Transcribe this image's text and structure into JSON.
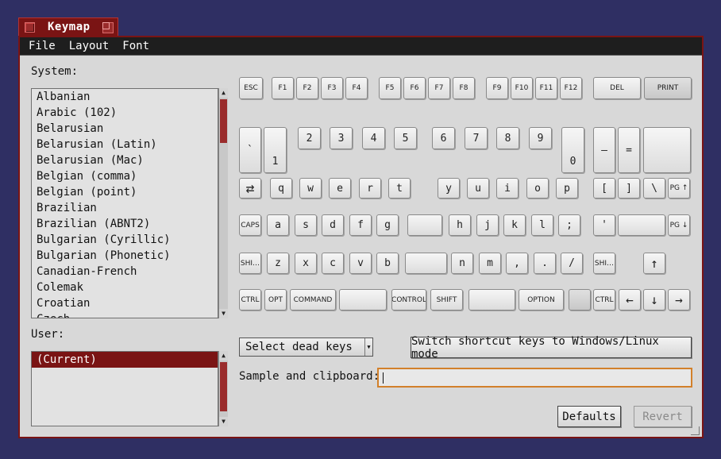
{
  "window": {
    "title": "Keymap"
  },
  "menu": [
    "File",
    "Layout",
    "Font"
  ],
  "system": {
    "label": "System:",
    "items": [
      "Albanian",
      "Arabic (102)",
      "Belarusian",
      "Belarusian (Latin)",
      "Belarusian (Mac)",
      "Belgian (comma)",
      "Belgian (point)",
      "Brazilian",
      "Brazilian (ABNT2)",
      "Bulgarian (Cyrillic)",
      "Bulgarian (Phonetic)",
      "Canadian-French",
      "Colemak",
      "Croatian",
      "Czech"
    ]
  },
  "user": {
    "label": "User:",
    "items": [
      "(Current)"
    ]
  },
  "keys": {
    "esc": "ESC",
    "f1": "F1",
    "f2": "F2",
    "f3": "F3",
    "f4": "F4",
    "f5": "F5",
    "f6": "F6",
    "f7": "F7",
    "f8": "F8",
    "f9": "F9",
    "f10": "F10",
    "f11": "F11",
    "f12": "F12",
    "del": "DEL",
    "print": "PRINT",
    "backtick": "`",
    "n1": "1",
    "n2": "2",
    "n3": "3",
    "n4": "4",
    "n5": "5",
    "n6": "6",
    "n7": "7",
    "n8": "8",
    "n9": "9",
    "n0": "0",
    "minus": "–",
    "equal": "=",
    "backspace": "",
    "tab": "⇄",
    "q": "q",
    "w": "w",
    "e": "e",
    "r": "r",
    "t": "t",
    "y": "y",
    "u": "u",
    "i": "i",
    "o": "o",
    "p": "p",
    "lbracket": "[",
    "rbracket": "]",
    "backslash": "\\",
    "pgup": "PG ↑",
    "caps": "CAPS",
    "a": "a",
    "s": "s",
    "d": "d",
    "f": "f",
    "g": "g",
    "blank1": "",
    "h": "h",
    "j": "j",
    "k": "k",
    "l": "l",
    "semicolon": ";",
    "quote": "'",
    "enter": "",
    "pgdn": "PG ↓",
    "lshift": "SHI…",
    "z": "z",
    "x": "x",
    "c": "c",
    "v": "v",
    "b": "b",
    "blank2": "",
    "n": "n",
    "m": "m",
    "comma": ",",
    "period": ".",
    "slash": "/",
    "rshift": "SHI…",
    "up": "↑",
    "lctrl": "CTRL",
    "opt": "OPT",
    "command": "COMMAND",
    "space1": "",
    "control": "CONTROL",
    "shift": "SHIFT",
    "space2": "",
    "option": "OPTION",
    "blank3": "",
    "rctrl": "CTRL",
    "left": "←",
    "down": "↓",
    "right": "→"
  },
  "dead_keys": {
    "label": "Select dead keys"
  },
  "switch_button": {
    "label": "Switch shortcut keys to Windows/Linux mode"
  },
  "sample": {
    "label": "Sample and clipboard:",
    "value": ""
  },
  "defaults_button": {
    "label": "Defaults"
  },
  "revert_button": {
    "label": "Revert"
  }
}
